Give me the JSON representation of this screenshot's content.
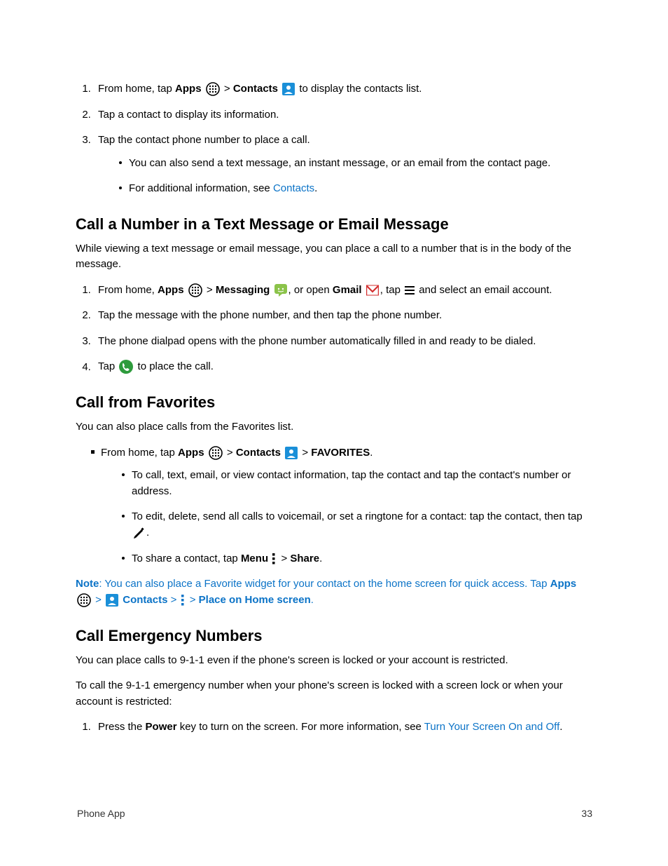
{
  "steps_top": {
    "s1_a": "From home, tap ",
    "s1_apps": "Apps",
    "s1_gt1": " > ",
    "s1_contacts": "Contacts",
    "s1_b": " to display the contacts list.",
    "s2": "Tap a contact to display its information.",
    "s3": "Tap the contact phone number to place a call.",
    "s3_sub1": "You can also send a text message, an instant message, or an email from the contact page.",
    "s3_sub2a": "For additional information, see ",
    "s3_sub2_link": "Contacts",
    "s3_sub2b": "."
  },
  "h2_1": "Call a Number in a Text Message or Email Message",
  "p1": "While viewing a text message or email message, you can place a call to a number that is in the body of the message.",
  "steps_msg": {
    "s1_a": "From home, ",
    "s1_apps": "Apps",
    "s1_gt1": " > ",
    "s1_messaging": "Messaging",
    "s1_b": ", or open ",
    "s1_gmail": "Gmail",
    "s1_c": ", tap ",
    "s1_d": " and select an email account.",
    "s2": "Tap the message with the phone number, and then tap the phone number.",
    "s3": "The phone dialpad opens with the phone number automatically filled in and ready to be dialed.",
    "s4_a": "Tap ",
    "s4_b": " to place the call."
  },
  "h2_2": "Call from Favorites",
  "p2": "You can also place calls from the Favorites list.",
  "fav": {
    "main_a": "From home, tap ",
    "main_apps": "Apps",
    "main_gt1": " > ",
    "main_contacts": "Contacts",
    "main_gt2": "  > ",
    "main_fav": "FAVORITES",
    "main_b": ".",
    "sub1": "To call, text, email, or view contact information, tap the contact and tap the contact's number or address.",
    "sub2_a": "To edit, delete, send all calls to voicemail, or set a ringtone for a contact: tap the contact, then tap ",
    "sub2_b": ".",
    "sub3_a": "To share a contact, tap ",
    "sub3_menu": "Menu",
    "sub3_gt": "  > ",
    "sub3_share": "Share",
    "sub3_b": "."
  },
  "note": {
    "label": "Note",
    "text_a": ": You can also place a Favorite widget for your contact on the home screen for quick access. Tap ",
    "apps": "Apps",
    "gt1": " > ",
    "contacts": " Contacts",
    "gt2": " > ",
    "gt3": "  > ",
    "place": "Place on Home screen",
    "text_b": "."
  },
  "h2_3": "Call Emergency Numbers",
  "p3": "You can place calls to 9-1-1 even if the phone's screen is locked or your account is restricted.",
  "p4": "To call the 9-1-1 emergency number when your phone's screen is locked with a screen lock or when your account is restricted:",
  "steps_emerg": {
    "s1_a": "Press the ",
    "s1_power": "Power",
    "s1_b": " key to turn on the screen. For more information, see ",
    "s1_link": "Turn Your Screen On and Off",
    "s1_c": "."
  },
  "footer": {
    "left": "Phone App",
    "right": "33"
  }
}
